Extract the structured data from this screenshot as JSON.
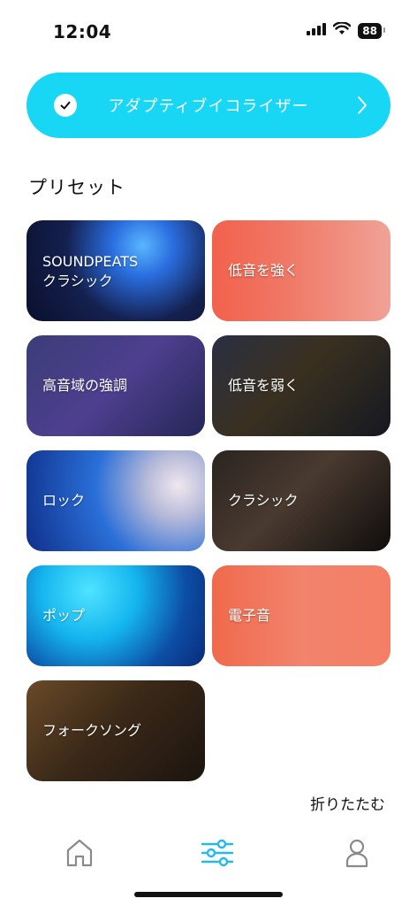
{
  "status": {
    "time": "12:04",
    "battery": "88",
    "signal_icon": "cellular-signal-icon",
    "wifi_icon": "wifi-icon"
  },
  "adaptive_eq": {
    "label": "アダプティブイコライザー",
    "enabled": true,
    "check_icon": "check-icon",
    "chevron_icon": "chevron-right-icon",
    "color": "#18d7f4"
  },
  "presets": {
    "title": "プリセット",
    "items": [
      {
        "label": "SOUNDPEATS\nクラシック",
        "image": "violinist-photo"
      },
      {
        "label": "低音を強く",
        "image": "headphone-listener-photo"
      },
      {
        "label": "高音域の強調",
        "image": "drummer-photo"
      },
      {
        "label": "低音を弱く",
        "image": "studio-musicians-photo"
      },
      {
        "label": "ロック",
        "image": "rock-guitarist-photo"
      },
      {
        "label": "クラシック",
        "image": "orchestra-photo"
      },
      {
        "label": "ポップ",
        "image": "concert-crowd-photo"
      },
      {
        "label": "電子音",
        "image": "electric-guitarist-photo"
      },
      {
        "label": "フォークソング",
        "image": "acoustic-guitar-photo"
      }
    ]
  },
  "collapse_label": "折りたたむ",
  "tabbar": {
    "home_icon": "home-icon",
    "eq_icon": "equalizer-sliders-icon",
    "profile_icon": "user-icon",
    "active": "equalizer",
    "active_color": "#22b8f0",
    "inactive_color": "#8a8a8a"
  }
}
